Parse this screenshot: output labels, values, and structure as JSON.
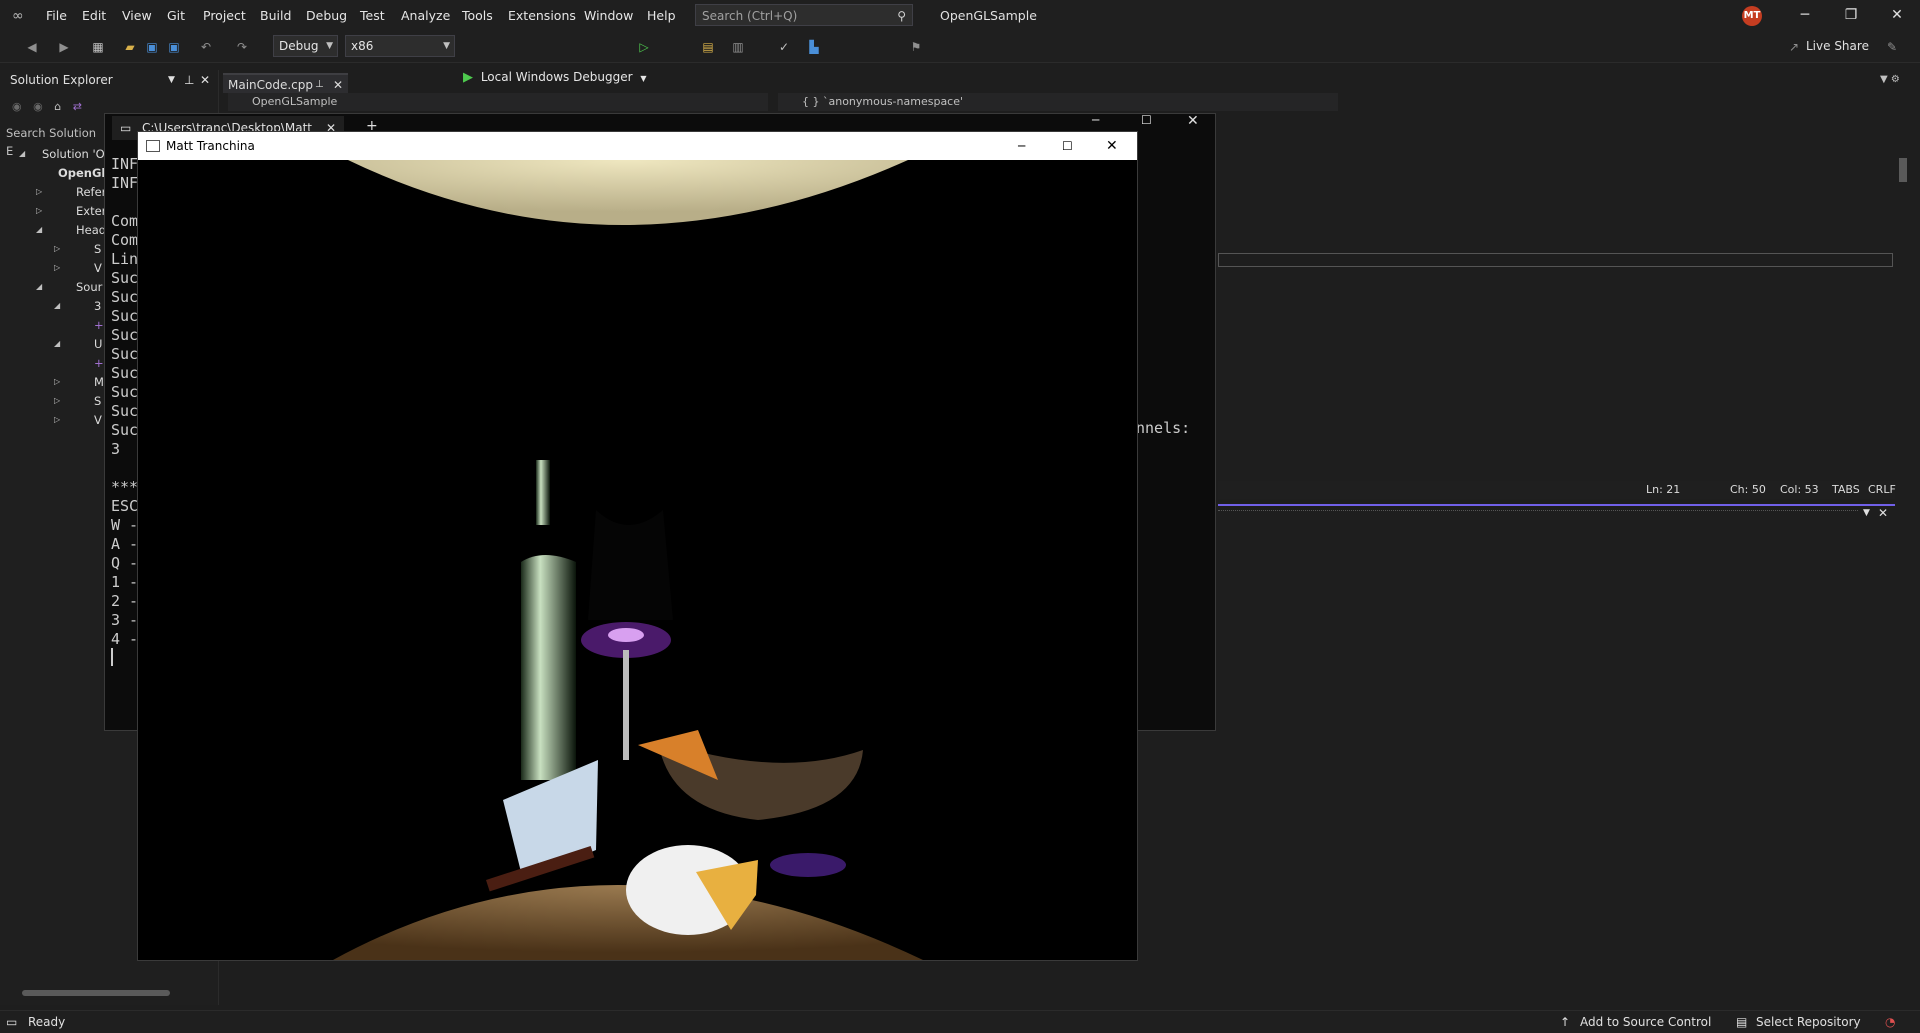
{
  "menu": [
    "File",
    "Edit",
    "View",
    "Git",
    "Project",
    "Build",
    "Debug",
    "Test",
    "Analyze",
    "Tools",
    "Extensions",
    "Window",
    "Help"
  ],
  "search": {
    "placeholder": "Search (Ctrl+Q)"
  },
  "app_title": "OpenGLSample",
  "avatar_initials": "MT",
  "toolbar": {
    "config": "Debug",
    "platform": "x86",
    "debugger": "Local Windows Debugger",
    "live_share": "Live Share"
  },
  "solution_explorer": {
    "title": "Solution Explorer",
    "search": "Search Solution E",
    "items": [
      "Solution 'O|",
      "OpenGl",
      "Refer",
      "Exter",
      "Head",
      "S",
      "V",
      "Sour",
      "3",
      "+",
      "U",
      "+",
      "M",
      "S",
      "V"
    ]
  },
  "editor": {
    "tab": "MainCode.cpp",
    "nav_project": "OpenGLSample",
    "nav_scope": "{ } `anonymous-namespace'",
    "ln": "Ln: 21",
    "ch": "Ch: 50",
    "col": "Col: 53",
    "tabs": "TABS",
    "crlf": "CRLF"
  },
  "console": {
    "tab_title": "C:\\Users\\tranc\\Desktop\\Matt",
    "lines": [
      "INF",
      "INF",
      "",
      "Com",
      "Com",
      "Lin",
      "Suc",
      "Suc",
      "Suc",
      "Suc",
      "Suc",
      "Suc",
      "Suc",
      "Suc",
      "Suc",
      "3",
      "",
      "***",
      "ESC",
      "W -",
      "A -",
      "Q -",
      "1 -",
      "2 -",
      "3 -",
      "4 -"
    ],
    "right_fragment": "nnels:"
  },
  "gl_window": {
    "title": "Matt Tranchina"
  },
  "statusbar": {
    "ready": "Ready",
    "source_control": "Add to Source Control",
    "repository": "Select Repository"
  }
}
